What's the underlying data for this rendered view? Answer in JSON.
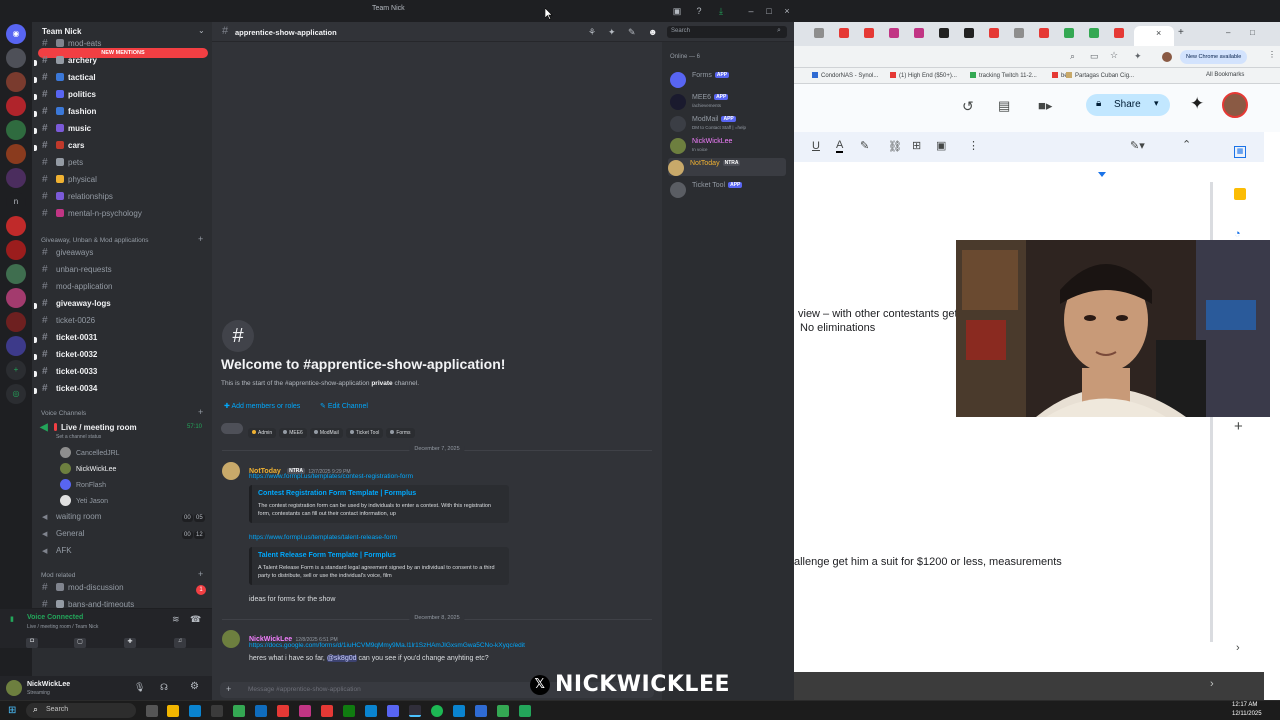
{
  "discord": {
    "window_title": "Team Nick",
    "server_name": "Team Nick",
    "new_mentions": "NEW MENTIONS",
    "channels_top": [
      {
        "name": "mod-eats",
        "bold": false
      },
      {
        "name": "archery",
        "bold": true
      },
      {
        "name": "tactical",
        "bold": true
      },
      {
        "name": "politics",
        "bold": true
      },
      {
        "name": "fashion",
        "bold": true
      },
      {
        "name": "music",
        "bold": true
      },
      {
        "name": "cars",
        "bold": true
      },
      {
        "name": "pets",
        "bold": false
      },
      {
        "name": "physical",
        "bold": false
      },
      {
        "name": "relationships",
        "bold": false
      },
      {
        "name": "mental-n-psychology",
        "bold": false
      }
    ],
    "category_giveaway": "Giveaway, Unban & Mod applications",
    "channels_giveaway": [
      {
        "name": "giveaways",
        "bold": false
      },
      {
        "name": "unban-requests",
        "bold": false
      },
      {
        "name": "mod-application",
        "bold": false
      },
      {
        "name": "giveaway-logs",
        "bold": true
      },
      {
        "name": "ticket-0026",
        "bold": false
      },
      {
        "name": "ticket-0031",
        "bold": true
      },
      {
        "name": "ticket-0032",
        "bold": true
      },
      {
        "name": "ticket-0033",
        "bold": true
      },
      {
        "name": "ticket-0034",
        "bold": true
      }
    ],
    "category_voice": "Voice Channels",
    "voice_live": "Live / meeting room",
    "voice_live_time": "57:10",
    "voice_status": "Set a channel status",
    "voice_users": [
      "CancelledJRL",
      "NickWickLee",
      "RonFlash",
      "Yeti Jason"
    ],
    "voice_other": [
      {
        "name": "waiting room",
        "a": "00",
        "b": "05"
      },
      {
        "name": "General",
        "a": "00",
        "b": "12"
      },
      {
        "name": "AFK",
        "a": "",
        "b": ""
      }
    ],
    "category_mod": "Mod related",
    "channels_mod": [
      {
        "name": "mod-discussion",
        "badge": "1"
      },
      {
        "name": "bans-and-timeouts",
        "badge": ""
      },
      {
        "name": "mod-voice",
        "badge": ""
      }
    ],
    "voice_connected": "Voice Connected",
    "voice_connected_sub": "Live / meeting room / Team Nick",
    "user_name": "NickWickLee",
    "user_status": "Streaming",
    "search_placeholder": "Search",
    "channel_title": "apprentice-show-application",
    "online_header": "Online — 6",
    "members": [
      {
        "name": "Forms",
        "tag": "APP",
        "sub": "",
        "color": "#949ba4",
        "avatar": "#5865f2"
      },
      {
        "name": "MEE6",
        "tag": "APP",
        "sub": "/achievements",
        "color": "#949ba4",
        "avatar": "#1a1a2e"
      },
      {
        "name": "ModMail",
        "tag": "APP",
        "sub": "DM to Contact Staff | =help",
        "color": "#949ba4",
        "avatar": "#3b3e45"
      },
      {
        "name": "NickWickLee",
        "tag": "",
        "sub": "In voice",
        "color": "#f47fff",
        "avatar": "#6d7f3f"
      },
      {
        "name": "NotToday",
        "tag": "NTRA",
        "sub": "",
        "color": "#f0b232",
        "avatar": "#c8a96a"
      },
      {
        "name": "Ticket Tool",
        "tag": "APP",
        "sub": "",
        "color": "#949ba4",
        "avatar": "#5a5d63"
      }
    ],
    "welcome_title": "Welcome to #apprentice-show-application!",
    "welcome_sub_prefix": "This is the start of the #apprentice-show-application ",
    "welcome_sub_bold": "private",
    "welcome_sub_suffix": " channel.",
    "add_members": "Add members or roles",
    "edit_channel": "Edit Channel",
    "role_pills": [
      "Admin",
      "MEE6",
      "ModMail",
      "Ticket Tool",
      "Forms"
    ],
    "date1": "December 7, 2025",
    "msg1": {
      "author": "NotToday",
      "tag": "NTRA",
      "time": "12/7/2025 9:29 PM",
      "link1": "https://www.formpl.us/templates/contest-registration-form",
      "embed1_title": "Contest Registration Form Template | Formplus",
      "embed1_desc": "The contest registration form can be used by individuals to enter a contest. With this registration form, contestants can fill out their contact information, up",
      "link2": "https://www.formpl.us/templates/talent-release-form",
      "embed2_title": "Talent Release Form Template | Formplus",
      "embed2_desc": "A Talent Release Form is a standard legal agreement signed by an individual to consent to a third party to distribute, sell or use the individual's voice, film",
      "text": "ideas for forms for the show"
    },
    "date2": "December 8, 2025",
    "msg2": {
      "author": "NickWickLee",
      "time": "12/8/2025 6:51 PM",
      "link": "https://docs.google.com/forms/d/1iuHCVM9qMmy9Ma.l1lr1SzHAmJIGxsmGwa5CNo-kXyqc/edit",
      "text_prefix": "heres what i have so far, ",
      "mention": "@sk8g0d",
      "text_suffix": " can you see if you'd change anyhting etc?"
    },
    "input_placeholder": "Message #apprentice-show-application"
  },
  "chrome": {
    "new_chrome": "New Chrome available",
    "bookmarks": [
      "CondorNAS - Synol...",
      "(1) High End ($50+)...",
      "tracking Twitch 11-2...",
      "be",
      "Partagas Cuban Cig..."
    ],
    "all_bookmarks": "All Bookmarks",
    "share_label": "Share",
    "doc_line1": "view – with other contestants get",
    "doc_line2": "No eliminations",
    "doc_line3": "allenge get him a suit for $1200 or less, measurements"
  },
  "watermark": "NICKWICKLEE",
  "taskbar": {
    "search": "Search",
    "time": "12:17 AM",
    "date": "12/11/2025"
  }
}
